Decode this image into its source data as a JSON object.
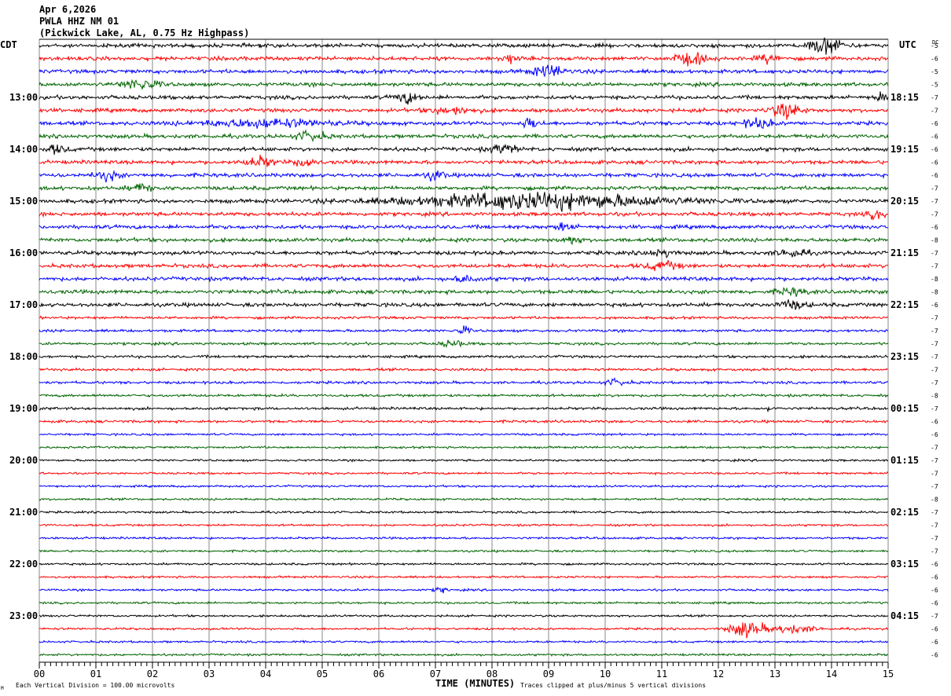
{
  "header": {
    "date": "Apr 6,2026",
    "station": "PWLA HHZ NM 01",
    "description": "(Pickwick Lake, AL, 0.75 Hz Highpass)"
  },
  "left_axis": {
    "timezone": "CDT",
    "hour_labels": [
      "13:00",
      "14:00",
      "15:00",
      "16:00",
      "17:00",
      "18:00",
      "19:00",
      "20:00",
      "21:00",
      "22:00",
      "23:00"
    ]
  },
  "right_axis": {
    "timezone": "UTC",
    "dc_label": "DC",
    "hour_labels": [
      "18:15",
      "19:15",
      "20:15",
      "21:15",
      "22:15",
      "23:15",
      "00:15",
      "01:15",
      "02:15",
      "03:15",
      "04:15"
    ]
  },
  "footer": {
    "xlabel": "TIME (MINUTES)",
    "scale_note": "Each Vertical Division =  100.00 microvolts",
    "clip_note": "Traces clipped at plus/minus 5 vertical divisions",
    "corner_mark": "M"
  },
  "chart_data": {
    "type": "line",
    "subtype": "helicorder",
    "xlabel": "TIME (MINUTES)",
    "xlim": [
      0,
      15
    ],
    "x_ticks": [
      "00",
      "01",
      "02",
      "03",
      "04",
      "05",
      "06",
      "07",
      "08",
      "09",
      "10",
      "11",
      "12",
      "13",
      "14",
      "15"
    ],
    "grid": true,
    "trace_colors": [
      "#000000",
      "#ff0000",
      "#0000ff",
      "#006400"
    ],
    "rows_per_hour": 4,
    "row_count": 48,
    "dc_offsets": [
      -5,
      -6,
      -5,
      -5,
      -7,
      -7,
      -6,
      -6,
      -6,
      -6,
      -6,
      -7,
      -7,
      -7,
      -6,
      -8,
      -7,
      -7,
      -8,
      -8,
      -6,
      -7,
      -7,
      -7,
      -7,
      -7,
      -7,
      -8,
      -7,
      -6,
      -6,
      -7,
      -7,
      -7,
      -7,
      -8,
      -7,
      -7,
      -7,
      -7,
      -6,
      -6,
      -6,
      -6,
      -7,
      -6,
      -6,
      -6
    ],
    "events": [
      {
        "row": 0,
        "minute": 13.9,
        "duration": 0.6,
        "amplitude": 3
      },
      {
        "row": 1,
        "minute": 11.5,
        "duration": 0.6,
        "amplitude": 2
      },
      {
        "row": 1,
        "minute": 12.9,
        "duration": 0.4,
        "amplitude": 1.5
      },
      {
        "row": 1,
        "minute": 8.3,
        "duration": 0.3,
        "amplitude": 1.5
      },
      {
        "row": 2,
        "minute": 9.0,
        "duration": 0.6,
        "amplitude": 2
      },
      {
        "row": 3,
        "minute": 1.8,
        "duration": 0.6,
        "amplitude": 2
      },
      {
        "row": 4,
        "minute": 6.5,
        "duration": 0.4,
        "amplitude": 2
      },
      {
        "row": 4,
        "minute": 14.9,
        "duration": 0.2,
        "amplitude": 2.5
      },
      {
        "row": 5,
        "minute": 13.2,
        "duration": 0.5,
        "amplitude": 3
      },
      {
        "row": 5,
        "minute": 7.3,
        "duration": 0.8,
        "amplitude": 1.2
      },
      {
        "row": 6,
        "minute": 4.0,
        "duration": 2.2,
        "amplitude": 1.5
      },
      {
        "row": 6,
        "minute": 8.7,
        "duration": 0.3,
        "amplitude": 2
      },
      {
        "row": 6,
        "minute": 12.7,
        "duration": 0.5,
        "amplitude": 1.8
      },
      {
        "row": 7,
        "minute": 4.8,
        "duration": 0.5,
        "amplitude": 1.8
      },
      {
        "row": 8,
        "minute": 0.3,
        "duration": 0.4,
        "amplitude": 1.5
      },
      {
        "row": 8,
        "minute": 8.2,
        "duration": 0.5,
        "amplitude": 1.5
      },
      {
        "row": 9,
        "minute": 3.9,
        "duration": 0.5,
        "amplitude": 1.8
      },
      {
        "row": 9,
        "minute": 4.7,
        "duration": 0.3,
        "amplitude": 2.2
      },
      {
        "row": 10,
        "minute": 1.2,
        "duration": 0.4,
        "amplitude": 1.8
      },
      {
        "row": 10,
        "minute": 7.0,
        "duration": 0.3,
        "amplitude": 1.8
      },
      {
        "row": 11,
        "minute": 1.8,
        "duration": 0.4,
        "amplitude": 1.5
      },
      {
        "row": 12,
        "minute": 8.8,
        "duration": 4.5,
        "amplitude": 3
      },
      {
        "row": 13,
        "minute": 14.8,
        "duration": 0.3,
        "amplitude": 1.5
      },
      {
        "row": 14,
        "minute": 9.3,
        "duration": 0.3,
        "amplitude": 1.5
      },
      {
        "row": 15,
        "minute": 9.4,
        "duration": 0.3,
        "amplitude": 1.5
      },
      {
        "row": 16,
        "minute": 11.0,
        "duration": 0.5,
        "amplitude": 1.2
      },
      {
        "row": 16,
        "minute": 13.3,
        "duration": 0.5,
        "amplitude": 1.5
      },
      {
        "row": 17,
        "minute": 11.0,
        "duration": 0.6,
        "amplitude": 1.5
      },
      {
        "row": 18,
        "minute": 7.5,
        "duration": 0.4,
        "amplitude": 1.2
      },
      {
        "row": 19,
        "minute": 13.3,
        "duration": 0.5,
        "amplitude": 1.2
      },
      {
        "row": 20,
        "minute": 13.3,
        "duration": 0.5,
        "amplitude": 1.5
      },
      {
        "row": 22,
        "minute": 7.5,
        "duration": 0.2,
        "amplitude": 1.8
      },
      {
        "row": 23,
        "minute": 7.3,
        "duration": 0.4,
        "amplitude": 1.2
      },
      {
        "row": 26,
        "minute": 10.2,
        "duration": 0.4,
        "amplitude": 1.2
      },
      {
        "row": 28,
        "minute": 12.9,
        "duration": 0.05,
        "amplitude": 1.8
      },
      {
        "row": 42,
        "minute": 7.1,
        "duration": 0.2,
        "amplitude": 1.2
      },
      {
        "row": 45,
        "minute": 12.5,
        "duration": 0.6,
        "amplitude": 3
      },
      {
        "row": 45,
        "minute": 13.3,
        "duration": 0.8,
        "amplitude": 1.5
      }
    ]
  }
}
